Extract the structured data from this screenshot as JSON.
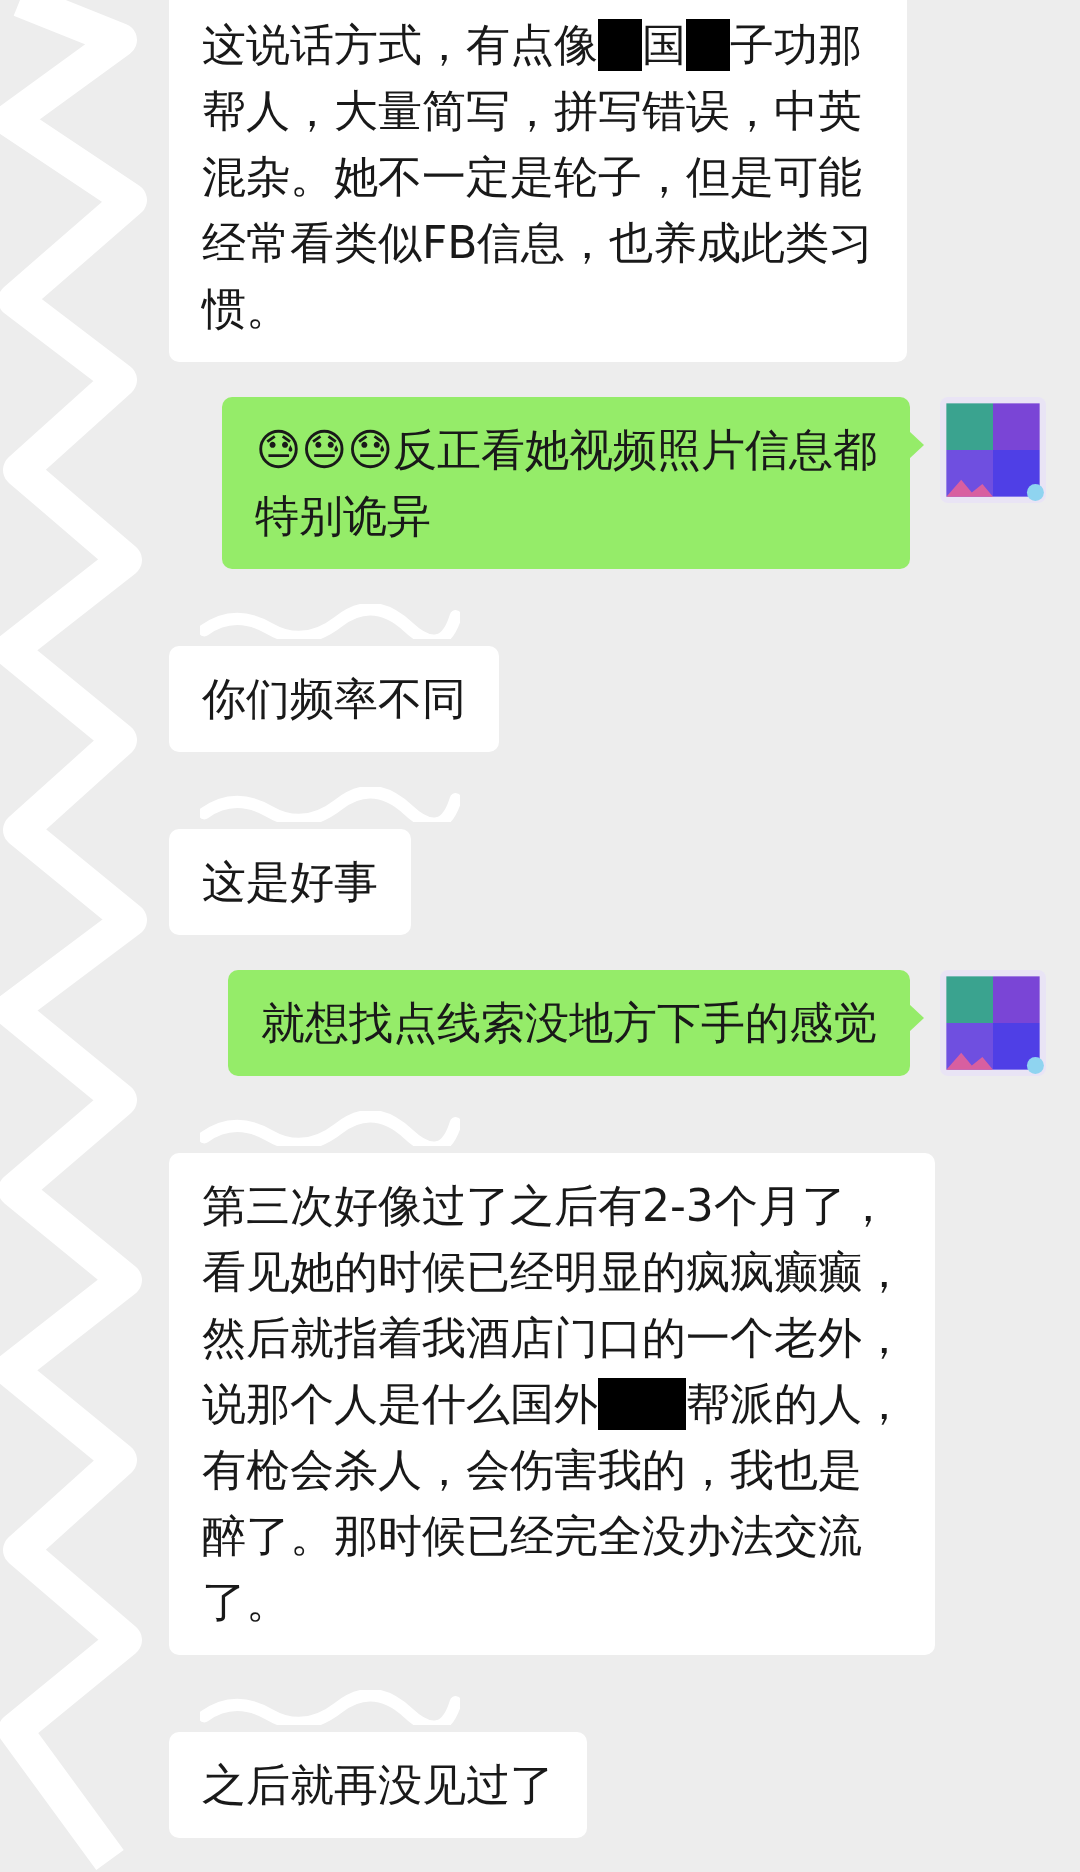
{
  "messages": [
    {
      "kind": "incoming",
      "lines": [
        [
          {
            "kind": "text",
            "text": "这说话方式，有点像"
          },
          {
            "kind": "redaction"
          },
          {
            "kind": "text",
            "text": "国"
          },
          {
            "kind": "redaction"
          },
          {
            "kind": "text",
            "text": "子功那"
          }
        ],
        [
          {
            "kind": "text",
            "text": "帮人，大量简写，拼写错误，中英"
          }
        ],
        [
          {
            "kind": "text",
            "text": "混杂。她不一定是轮子，但是可能"
          }
        ],
        [
          {
            "kind": "text",
            "text": "经常看类似FB信息，也养成此类习"
          }
        ],
        [
          {
            "kind": "text",
            "text": "惯。"
          }
        ]
      ]
    },
    {
      "kind": "outgoing",
      "lines": [
        [
          {
            "kind": "text",
            "text": "😓😓😓反正看她视频照片信息都"
          }
        ],
        [
          {
            "kind": "text",
            "text": "特别诡异"
          }
        ]
      ]
    },
    {
      "kind": "incoming",
      "lines": [
        [
          {
            "kind": "text",
            "text": "你们频率不同"
          }
        ]
      ]
    },
    {
      "kind": "incoming",
      "lines": [
        [
          {
            "kind": "text",
            "text": "这是好事"
          }
        ]
      ]
    },
    {
      "kind": "outgoing",
      "lines": [
        [
          {
            "kind": "text",
            "text": "就想找点线索没地方下手的感觉"
          }
        ]
      ]
    },
    {
      "kind": "incoming",
      "lines": [
        [
          {
            "kind": "text",
            "text": "第三次好像过了之后有2-3个月了，"
          }
        ],
        [
          {
            "kind": "text",
            "text": "看见她的时候已经明显的疯疯癫癫，"
          }
        ],
        [
          {
            "kind": "text",
            "text": "然后就指着我酒店门口的一个老外，"
          }
        ],
        [
          {
            "kind": "text",
            "text": "说那个人是什么国外"
          },
          {
            "kind": "redaction"
          },
          {
            "kind": "redaction"
          },
          {
            "kind": "text",
            "text": "帮派的人，"
          }
        ],
        [
          {
            "kind": "text",
            "text": "有枪会杀人，会伤害我的，我也是"
          }
        ],
        [
          {
            "kind": "text",
            "text": "醉了。那时候已经完全没办法交流"
          }
        ],
        [
          {
            "kind": "text",
            "text": "了。"
          }
        ]
      ]
    },
    {
      "kind": "incoming",
      "lines": [
        [
          {
            "kind": "text",
            "text": "之后就再没见过了"
          }
        ]
      ]
    }
  ]
}
